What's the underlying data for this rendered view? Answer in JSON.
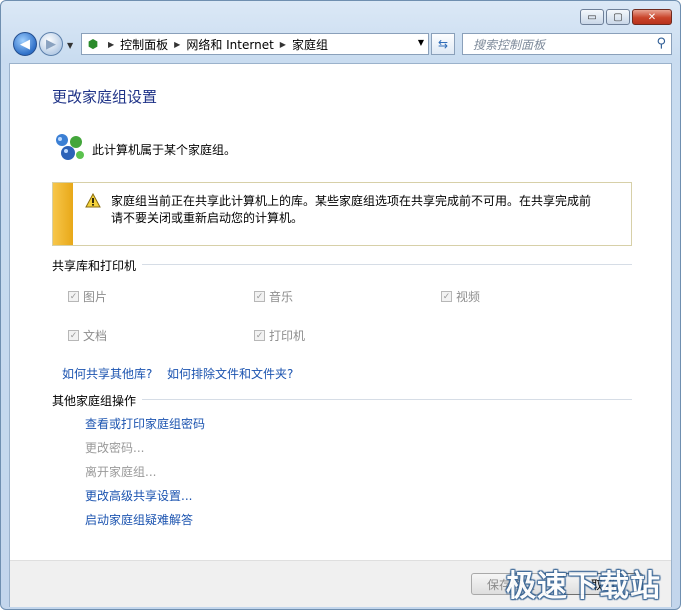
{
  "window": {
    "buttons": {
      "minimize": "▭",
      "maximize": "▢",
      "close": "✕"
    }
  },
  "nav": {
    "breadcrumb": [
      "控制面板",
      "网络和 Internet",
      "家庭组"
    ],
    "search_placeholder": "搜索控制面板"
  },
  "page": {
    "title": "更改家庭组设置",
    "membership": "此计算机属于某个家庭组。",
    "warning_line1": "家庭组当前正在共享此计算机上的库。某些家庭组选项在共享完成前不可用。在共享完成前",
    "warning_line2": "请不要关闭或重新启动您的计算机。"
  },
  "sharing": {
    "heading": "共享库和打印机",
    "items": [
      {
        "label": "图片",
        "checked": true
      },
      {
        "label": "音乐",
        "checked": true
      },
      {
        "label": "视频",
        "checked": true
      },
      {
        "label": "文档",
        "checked": true
      },
      {
        "label": "打印机",
        "checked": true
      }
    ],
    "link_other_libs": "如何共享其他库?",
    "link_exclude": "如何排除文件和文件夹?"
  },
  "actions": {
    "heading": "其他家庭组操作",
    "items": [
      {
        "label": "查看或打印家庭组密码",
        "enabled": true
      },
      {
        "label": "更改密码...",
        "enabled": false
      },
      {
        "label": "离开家庭组...",
        "enabled": false
      },
      {
        "label": "更改高级共享设置...",
        "enabled": true
      },
      {
        "label": "启动家庭组疑难解答",
        "enabled": true
      }
    ]
  },
  "footer": {
    "save_label": "保存修改",
    "cancel_label": "取消"
  },
  "watermark": "极速下载站",
  "colors": {
    "link": "#1c54b0",
    "title": "#1e3287",
    "warning_bar": "#f0b62c"
  }
}
